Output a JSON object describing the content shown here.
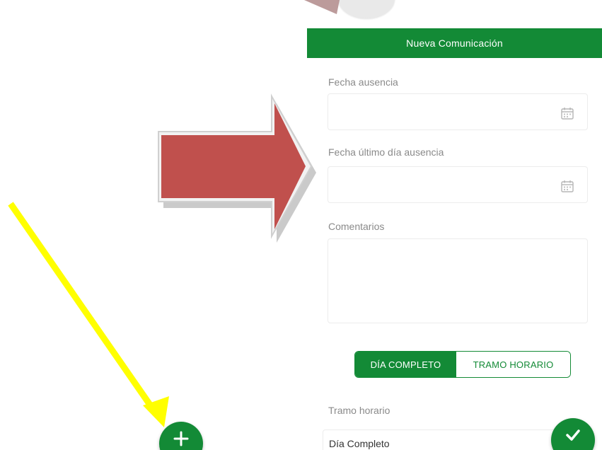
{
  "header": {
    "title": "Nueva Comunicación"
  },
  "form": {
    "fecha_ausencia": {
      "label": "Fecha ausencia",
      "value": ""
    },
    "fecha_ultimo_dia": {
      "label": "Fecha último día ausencia",
      "value": ""
    },
    "comentarios": {
      "label": "Comentarios",
      "value": ""
    },
    "modo": {
      "options": [
        "DÍA COMPLETO",
        "TRAMO HORARIO"
      ],
      "selected": "DÍA COMPLETO"
    },
    "tramo_horario": {
      "label": "Tramo horario",
      "value": "Día Completo"
    }
  },
  "icons": {
    "calendar": "calendar-icon",
    "add": "plus-icon",
    "confirm": "check-icon"
  },
  "colors": {
    "primary": "#138a36",
    "annotation_arrow_red": "#c0504d",
    "annotation_arrow_yellow": "#ffff00"
  }
}
